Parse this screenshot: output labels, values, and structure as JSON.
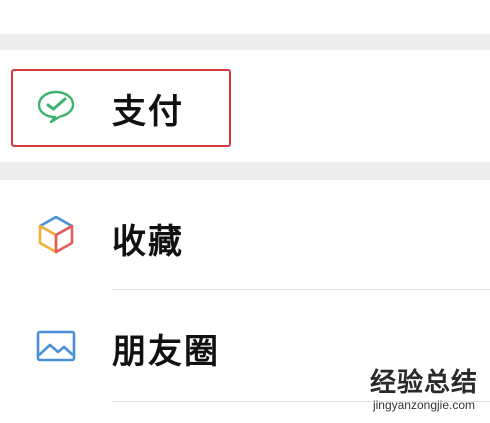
{
  "menu": {
    "pay": {
      "label": "支付",
      "icon": "wechat-pay-icon",
      "highlighted": true,
      "highlight_color": "#d9363e"
    },
    "favorites": {
      "label": "收藏",
      "icon": "favorites-cube-icon"
    },
    "moments": {
      "label": "朋友圈",
      "icon": "moments-image-icon"
    }
  },
  "watermark": {
    "title": "经验总结",
    "url": "jingyanzongjie.com"
  },
  "colors": {
    "background": "#ededed",
    "row": "#ffffff",
    "pay_green": "#3cb371",
    "moments_blue": "#4a90d9"
  }
}
